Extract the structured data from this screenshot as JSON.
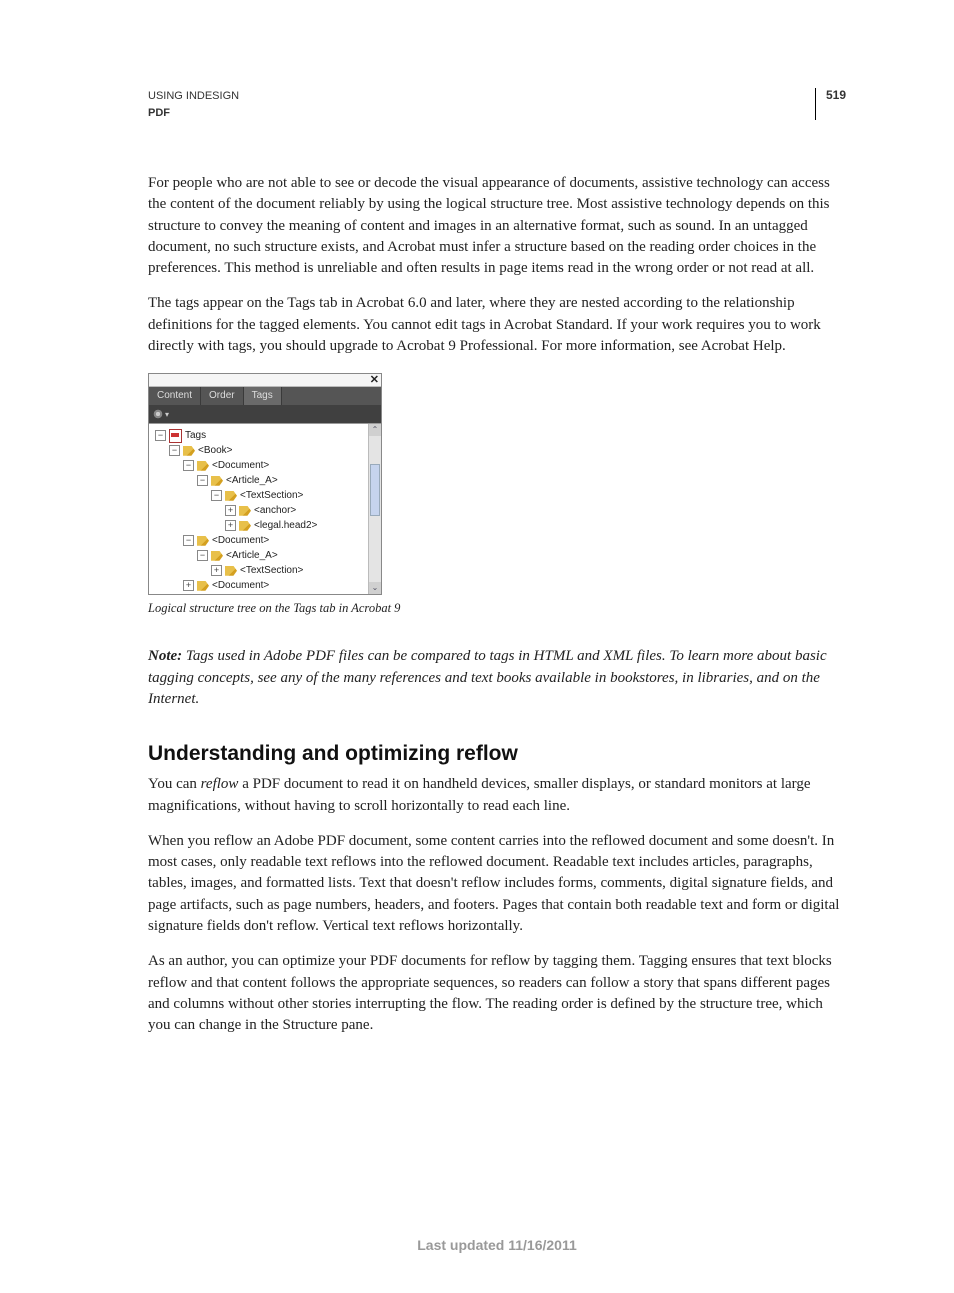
{
  "header": {
    "line1": "USING INDESIGN",
    "line2": "PDF",
    "page_number": "519"
  },
  "paragraphs": {
    "p1": "For people who are not able to see or decode the visual appearance of documents, assistive technology can access the content of the document reliably by using the logical structure tree. Most assistive technology depends on this structure to convey the meaning of content and images in an alternative format, such as sound. In an untagged document, no such structure exists, and Acrobat must infer a structure based on the reading order choices in the preferences. This method is unreliable and often results in page items read in the wrong order or not read at all.",
    "p2": "The tags appear on the Tags tab in Acrobat 6.0 and later, where they are nested according to the relationship definitions for the tagged elements. You cannot edit tags in Acrobat Standard. If your work requires you to work directly with tags, you should upgrade to Acrobat 9 Professional. For more information, see Acrobat Help.",
    "caption": "Logical structure tree on the Tags tab in Acrobat 9",
    "note_label": "Note:",
    "note_body": " Tags used in Adobe PDF files can be compared to tags in HTML and XML files. To learn more about basic tagging concepts, see any of the many references and text books available in bookstores, in libraries, and on the Internet.",
    "h2": "Understanding and optimizing reflow",
    "p3a": "You can ",
    "p3_reflow": "reflow",
    "p3b": " a PDF document to read it on handheld devices, smaller displays, or standard monitors at large magnifications, without having to scroll horizontally to read each line.",
    "p4": "When you reflow an Adobe PDF document, some content carries into the reflowed document and some doesn't. In most cases, only readable text reflows into the reflowed document. Readable text includes articles, paragraphs, tables, images, and formatted lists. Text that doesn't reflow includes forms, comments, digital signature fields, and page artifacts, such as page numbers, headers, and footers. Pages that contain both readable text and form or digital signature fields don't reflow. Vertical text reflows horizontally.",
    "p5": "As an author, you can optimize your PDF documents for reflow by tagging them. Tagging ensures that text blocks reflow and that content follows the appropriate sequences, so readers can follow a story that spans different pages and columns without other stories interrupting the flow. The reading order is defined by the structure tree, which you can change in the Structure pane."
  },
  "panel": {
    "tabs": {
      "content": "Content",
      "order": "Order",
      "tags": "Tags"
    },
    "tree": {
      "root": "Tags",
      "n1": "<Book>",
      "n2": "<Document>",
      "n3": "<Article_A>",
      "n4": "<TextSection>",
      "n5": "<anchor>",
      "n6": "<legal.head2>",
      "n7": "<Document>",
      "n8": "<Article_A>",
      "n9": "<TextSection>",
      "n10": "<Document>"
    }
  },
  "footer": "Last updated 11/16/2011"
}
